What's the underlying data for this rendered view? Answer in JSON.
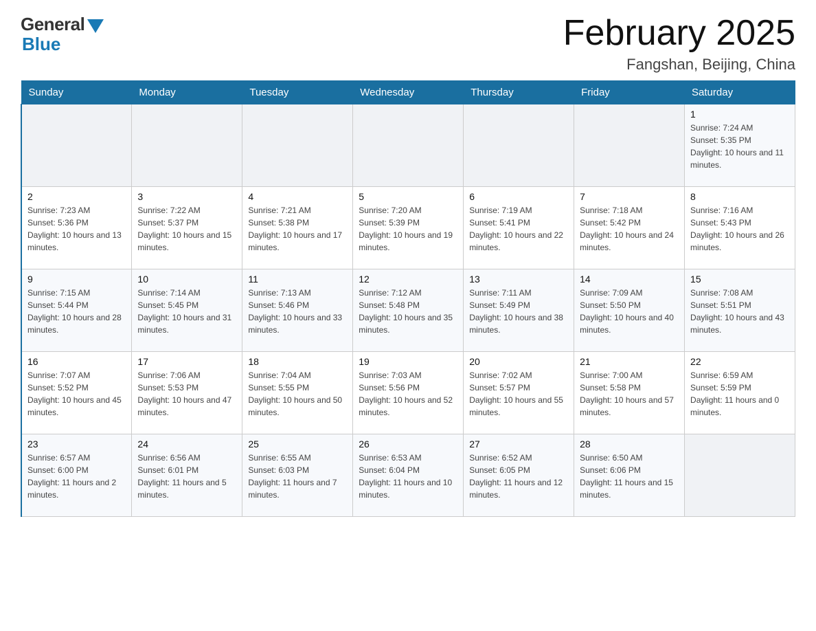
{
  "header": {
    "logo_general": "General",
    "logo_blue": "Blue",
    "title": "February 2025",
    "subtitle": "Fangshan, Beijing, China"
  },
  "weekdays": [
    "Sunday",
    "Monday",
    "Tuesday",
    "Wednesday",
    "Thursday",
    "Friday",
    "Saturday"
  ],
  "weeks": [
    [
      {
        "day": "",
        "info": ""
      },
      {
        "day": "",
        "info": ""
      },
      {
        "day": "",
        "info": ""
      },
      {
        "day": "",
        "info": ""
      },
      {
        "day": "",
        "info": ""
      },
      {
        "day": "",
        "info": ""
      },
      {
        "day": "1",
        "info": "Sunrise: 7:24 AM\nSunset: 5:35 PM\nDaylight: 10 hours and 11 minutes."
      }
    ],
    [
      {
        "day": "2",
        "info": "Sunrise: 7:23 AM\nSunset: 5:36 PM\nDaylight: 10 hours and 13 minutes."
      },
      {
        "day": "3",
        "info": "Sunrise: 7:22 AM\nSunset: 5:37 PM\nDaylight: 10 hours and 15 minutes."
      },
      {
        "day": "4",
        "info": "Sunrise: 7:21 AM\nSunset: 5:38 PM\nDaylight: 10 hours and 17 minutes."
      },
      {
        "day": "5",
        "info": "Sunrise: 7:20 AM\nSunset: 5:39 PM\nDaylight: 10 hours and 19 minutes."
      },
      {
        "day": "6",
        "info": "Sunrise: 7:19 AM\nSunset: 5:41 PM\nDaylight: 10 hours and 22 minutes."
      },
      {
        "day": "7",
        "info": "Sunrise: 7:18 AM\nSunset: 5:42 PM\nDaylight: 10 hours and 24 minutes."
      },
      {
        "day": "8",
        "info": "Sunrise: 7:16 AM\nSunset: 5:43 PM\nDaylight: 10 hours and 26 minutes."
      }
    ],
    [
      {
        "day": "9",
        "info": "Sunrise: 7:15 AM\nSunset: 5:44 PM\nDaylight: 10 hours and 28 minutes."
      },
      {
        "day": "10",
        "info": "Sunrise: 7:14 AM\nSunset: 5:45 PM\nDaylight: 10 hours and 31 minutes."
      },
      {
        "day": "11",
        "info": "Sunrise: 7:13 AM\nSunset: 5:46 PM\nDaylight: 10 hours and 33 minutes."
      },
      {
        "day": "12",
        "info": "Sunrise: 7:12 AM\nSunset: 5:48 PM\nDaylight: 10 hours and 35 minutes."
      },
      {
        "day": "13",
        "info": "Sunrise: 7:11 AM\nSunset: 5:49 PM\nDaylight: 10 hours and 38 minutes."
      },
      {
        "day": "14",
        "info": "Sunrise: 7:09 AM\nSunset: 5:50 PM\nDaylight: 10 hours and 40 minutes."
      },
      {
        "day": "15",
        "info": "Sunrise: 7:08 AM\nSunset: 5:51 PM\nDaylight: 10 hours and 43 minutes."
      }
    ],
    [
      {
        "day": "16",
        "info": "Sunrise: 7:07 AM\nSunset: 5:52 PM\nDaylight: 10 hours and 45 minutes."
      },
      {
        "day": "17",
        "info": "Sunrise: 7:06 AM\nSunset: 5:53 PM\nDaylight: 10 hours and 47 minutes."
      },
      {
        "day": "18",
        "info": "Sunrise: 7:04 AM\nSunset: 5:55 PM\nDaylight: 10 hours and 50 minutes."
      },
      {
        "day": "19",
        "info": "Sunrise: 7:03 AM\nSunset: 5:56 PM\nDaylight: 10 hours and 52 minutes."
      },
      {
        "day": "20",
        "info": "Sunrise: 7:02 AM\nSunset: 5:57 PM\nDaylight: 10 hours and 55 minutes."
      },
      {
        "day": "21",
        "info": "Sunrise: 7:00 AM\nSunset: 5:58 PM\nDaylight: 10 hours and 57 minutes."
      },
      {
        "day": "22",
        "info": "Sunrise: 6:59 AM\nSunset: 5:59 PM\nDaylight: 11 hours and 0 minutes."
      }
    ],
    [
      {
        "day": "23",
        "info": "Sunrise: 6:57 AM\nSunset: 6:00 PM\nDaylight: 11 hours and 2 minutes."
      },
      {
        "day": "24",
        "info": "Sunrise: 6:56 AM\nSunset: 6:01 PM\nDaylight: 11 hours and 5 minutes."
      },
      {
        "day": "25",
        "info": "Sunrise: 6:55 AM\nSunset: 6:03 PM\nDaylight: 11 hours and 7 minutes."
      },
      {
        "day": "26",
        "info": "Sunrise: 6:53 AM\nSunset: 6:04 PM\nDaylight: 11 hours and 10 minutes."
      },
      {
        "day": "27",
        "info": "Sunrise: 6:52 AM\nSunset: 6:05 PM\nDaylight: 11 hours and 12 minutes."
      },
      {
        "day": "28",
        "info": "Sunrise: 6:50 AM\nSunset: 6:06 PM\nDaylight: 11 hours and 15 minutes."
      },
      {
        "day": "",
        "info": ""
      }
    ]
  ]
}
